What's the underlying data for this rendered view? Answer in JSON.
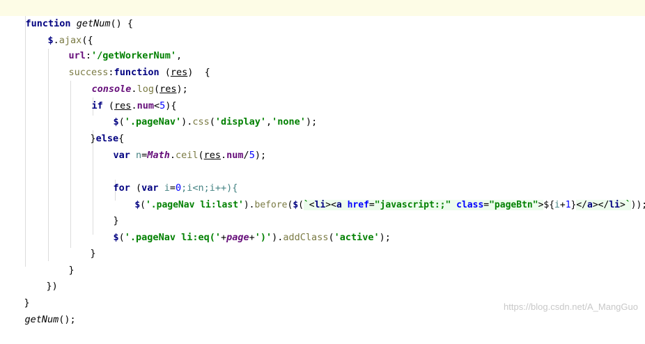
{
  "code": {
    "l1": {
      "kw": "function",
      "name": "getNum",
      "rest": "() {"
    },
    "l2": {
      "dollar": "$",
      "dot": ".",
      "method": "ajax",
      "open": "({"
    },
    "l3": {
      "key": "url",
      "colon": ":",
      "str": "'/getWorkerNum'",
      "comma": ","
    },
    "l4": {
      "key": "success",
      "colon": ":",
      "kw": "function",
      "open": " (",
      "param": "res",
      "close": ")  {"
    },
    "l5": {
      "obj": "console",
      "dot": ".",
      "method": "log",
      "open": "(",
      "param": "res",
      "close": ");"
    },
    "l6": {
      "kw": "if",
      "open": " (",
      "param": "res",
      "dot": ".",
      "prop": "num",
      "op": "<",
      "num": "5",
      "close": "){"
    },
    "l7": {
      "dollar": "$",
      "open": "(",
      "str1": "'.pageNav'",
      "mid": ").",
      "method": "css",
      "open2": "(",
      "str2": "'display'",
      "comma": ",",
      "str3": "'none'",
      "close": ");"
    },
    "l8": {
      "brace": "}",
      "kw": "else",
      "open": "{"
    },
    "l9": {
      "kw": "var",
      "var": " n",
      "eq": "=",
      "obj": "Math",
      "dot": ".",
      "method": "ceil",
      "open": "(",
      "param": "res",
      "dot2": ".",
      "prop": "num",
      "div": "/",
      "num": "5",
      "close": ");"
    },
    "l10": {
      "kw": "for",
      "open": " (",
      "kw2": "var",
      "rest1": " i",
      "eq": "=",
      "num": "0",
      "rest2": ";i<n;i++){"
    },
    "l11": {
      "dollar": "$",
      "open": "(",
      "str1": "'.pageNav li:last'",
      "mid": ").",
      "method": "before",
      "open2": "(",
      "dollar2": "$",
      "open3": "(",
      "tick": "`",
      "t1": "<",
      "tag1": "li",
      "t2": "><",
      "tag2": "a",
      "sp": " ",
      "attr1": "href",
      "eq1": "=",
      "val1": "\"javascript:;\"",
      "sp2": " ",
      "attr2": "class",
      "eq2": "=",
      "val2": "\"pageBtn\"",
      "t3": ">",
      "interp_open": "${",
      "iv": "i",
      "plus": "+",
      "one": "1",
      "interp_close": "}",
      "t4": "</",
      "tag3": "a",
      "t5": "></",
      "tag4": "li",
      "t6": ">",
      "tick2": "`",
      "close": "));"
    },
    "l12": {
      "brace": "}"
    },
    "l13": {
      "dollar": "$",
      "open": "(",
      "str1": "'.pageNav li:eq('",
      "plus1": "+",
      "var": "page",
      "plus2": "+",
      "str2": "')'",
      "mid": ").",
      "method": "addClass",
      "open2": "(",
      "str3": "'active'",
      "close": ");"
    },
    "l14": {
      "brace": "}"
    },
    "l15": {
      "brace": "}"
    },
    "l16": {
      "close": "})"
    },
    "l17": {
      "brace": "}"
    },
    "l18": {
      "name": "getNum",
      "rest": "();"
    }
  },
  "watermark": "https://blog.csdn.net/A_MangGuo"
}
